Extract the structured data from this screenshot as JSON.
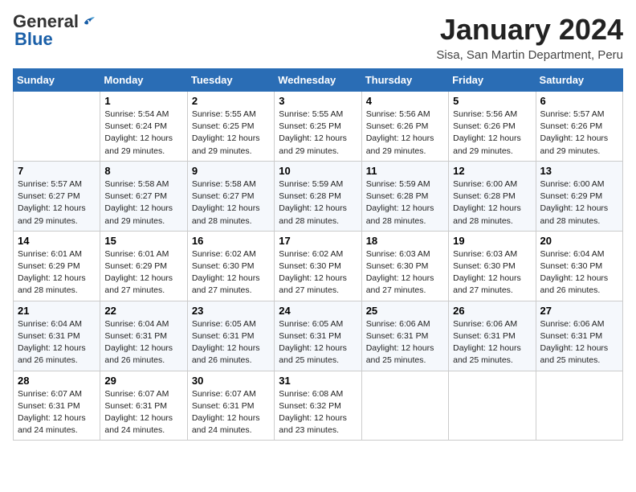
{
  "header": {
    "logo_general": "General",
    "logo_blue": "Blue",
    "month_title": "January 2024",
    "location": "Sisa, San Martin Department, Peru"
  },
  "weekdays": [
    "Sunday",
    "Monday",
    "Tuesday",
    "Wednesday",
    "Thursday",
    "Friday",
    "Saturday"
  ],
  "weeks": [
    [
      {
        "day": "",
        "info": ""
      },
      {
        "day": "1",
        "info": "Sunrise: 5:54 AM\nSunset: 6:24 PM\nDaylight: 12 hours\nand 29 minutes."
      },
      {
        "day": "2",
        "info": "Sunrise: 5:55 AM\nSunset: 6:25 PM\nDaylight: 12 hours\nand 29 minutes."
      },
      {
        "day": "3",
        "info": "Sunrise: 5:55 AM\nSunset: 6:25 PM\nDaylight: 12 hours\nand 29 minutes."
      },
      {
        "day": "4",
        "info": "Sunrise: 5:56 AM\nSunset: 6:26 PM\nDaylight: 12 hours\nand 29 minutes."
      },
      {
        "day": "5",
        "info": "Sunrise: 5:56 AM\nSunset: 6:26 PM\nDaylight: 12 hours\nand 29 minutes."
      },
      {
        "day": "6",
        "info": "Sunrise: 5:57 AM\nSunset: 6:26 PM\nDaylight: 12 hours\nand 29 minutes."
      }
    ],
    [
      {
        "day": "7",
        "info": "Sunrise: 5:57 AM\nSunset: 6:27 PM\nDaylight: 12 hours\nand 29 minutes."
      },
      {
        "day": "8",
        "info": "Sunrise: 5:58 AM\nSunset: 6:27 PM\nDaylight: 12 hours\nand 29 minutes."
      },
      {
        "day": "9",
        "info": "Sunrise: 5:58 AM\nSunset: 6:27 PM\nDaylight: 12 hours\nand 28 minutes."
      },
      {
        "day": "10",
        "info": "Sunrise: 5:59 AM\nSunset: 6:28 PM\nDaylight: 12 hours\nand 28 minutes."
      },
      {
        "day": "11",
        "info": "Sunrise: 5:59 AM\nSunset: 6:28 PM\nDaylight: 12 hours\nand 28 minutes."
      },
      {
        "day": "12",
        "info": "Sunrise: 6:00 AM\nSunset: 6:28 PM\nDaylight: 12 hours\nand 28 minutes."
      },
      {
        "day": "13",
        "info": "Sunrise: 6:00 AM\nSunset: 6:29 PM\nDaylight: 12 hours\nand 28 minutes."
      }
    ],
    [
      {
        "day": "14",
        "info": "Sunrise: 6:01 AM\nSunset: 6:29 PM\nDaylight: 12 hours\nand 28 minutes."
      },
      {
        "day": "15",
        "info": "Sunrise: 6:01 AM\nSunset: 6:29 PM\nDaylight: 12 hours\nand 27 minutes."
      },
      {
        "day": "16",
        "info": "Sunrise: 6:02 AM\nSunset: 6:30 PM\nDaylight: 12 hours\nand 27 minutes."
      },
      {
        "day": "17",
        "info": "Sunrise: 6:02 AM\nSunset: 6:30 PM\nDaylight: 12 hours\nand 27 minutes."
      },
      {
        "day": "18",
        "info": "Sunrise: 6:03 AM\nSunset: 6:30 PM\nDaylight: 12 hours\nand 27 minutes."
      },
      {
        "day": "19",
        "info": "Sunrise: 6:03 AM\nSunset: 6:30 PM\nDaylight: 12 hours\nand 27 minutes."
      },
      {
        "day": "20",
        "info": "Sunrise: 6:04 AM\nSunset: 6:30 PM\nDaylight: 12 hours\nand 26 minutes."
      }
    ],
    [
      {
        "day": "21",
        "info": "Sunrise: 6:04 AM\nSunset: 6:31 PM\nDaylight: 12 hours\nand 26 minutes."
      },
      {
        "day": "22",
        "info": "Sunrise: 6:04 AM\nSunset: 6:31 PM\nDaylight: 12 hours\nand 26 minutes."
      },
      {
        "day": "23",
        "info": "Sunrise: 6:05 AM\nSunset: 6:31 PM\nDaylight: 12 hours\nand 26 minutes."
      },
      {
        "day": "24",
        "info": "Sunrise: 6:05 AM\nSunset: 6:31 PM\nDaylight: 12 hours\nand 25 minutes."
      },
      {
        "day": "25",
        "info": "Sunrise: 6:06 AM\nSunset: 6:31 PM\nDaylight: 12 hours\nand 25 minutes."
      },
      {
        "day": "26",
        "info": "Sunrise: 6:06 AM\nSunset: 6:31 PM\nDaylight: 12 hours\nand 25 minutes."
      },
      {
        "day": "27",
        "info": "Sunrise: 6:06 AM\nSunset: 6:31 PM\nDaylight: 12 hours\nand 25 minutes."
      }
    ],
    [
      {
        "day": "28",
        "info": "Sunrise: 6:07 AM\nSunset: 6:31 PM\nDaylight: 12 hours\nand 24 minutes."
      },
      {
        "day": "29",
        "info": "Sunrise: 6:07 AM\nSunset: 6:31 PM\nDaylight: 12 hours\nand 24 minutes."
      },
      {
        "day": "30",
        "info": "Sunrise: 6:07 AM\nSunset: 6:31 PM\nDaylight: 12 hours\nand 24 minutes."
      },
      {
        "day": "31",
        "info": "Sunrise: 6:08 AM\nSunset: 6:32 PM\nDaylight: 12 hours\nand 23 minutes."
      },
      {
        "day": "",
        "info": ""
      },
      {
        "day": "",
        "info": ""
      },
      {
        "day": "",
        "info": ""
      }
    ]
  ]
}
